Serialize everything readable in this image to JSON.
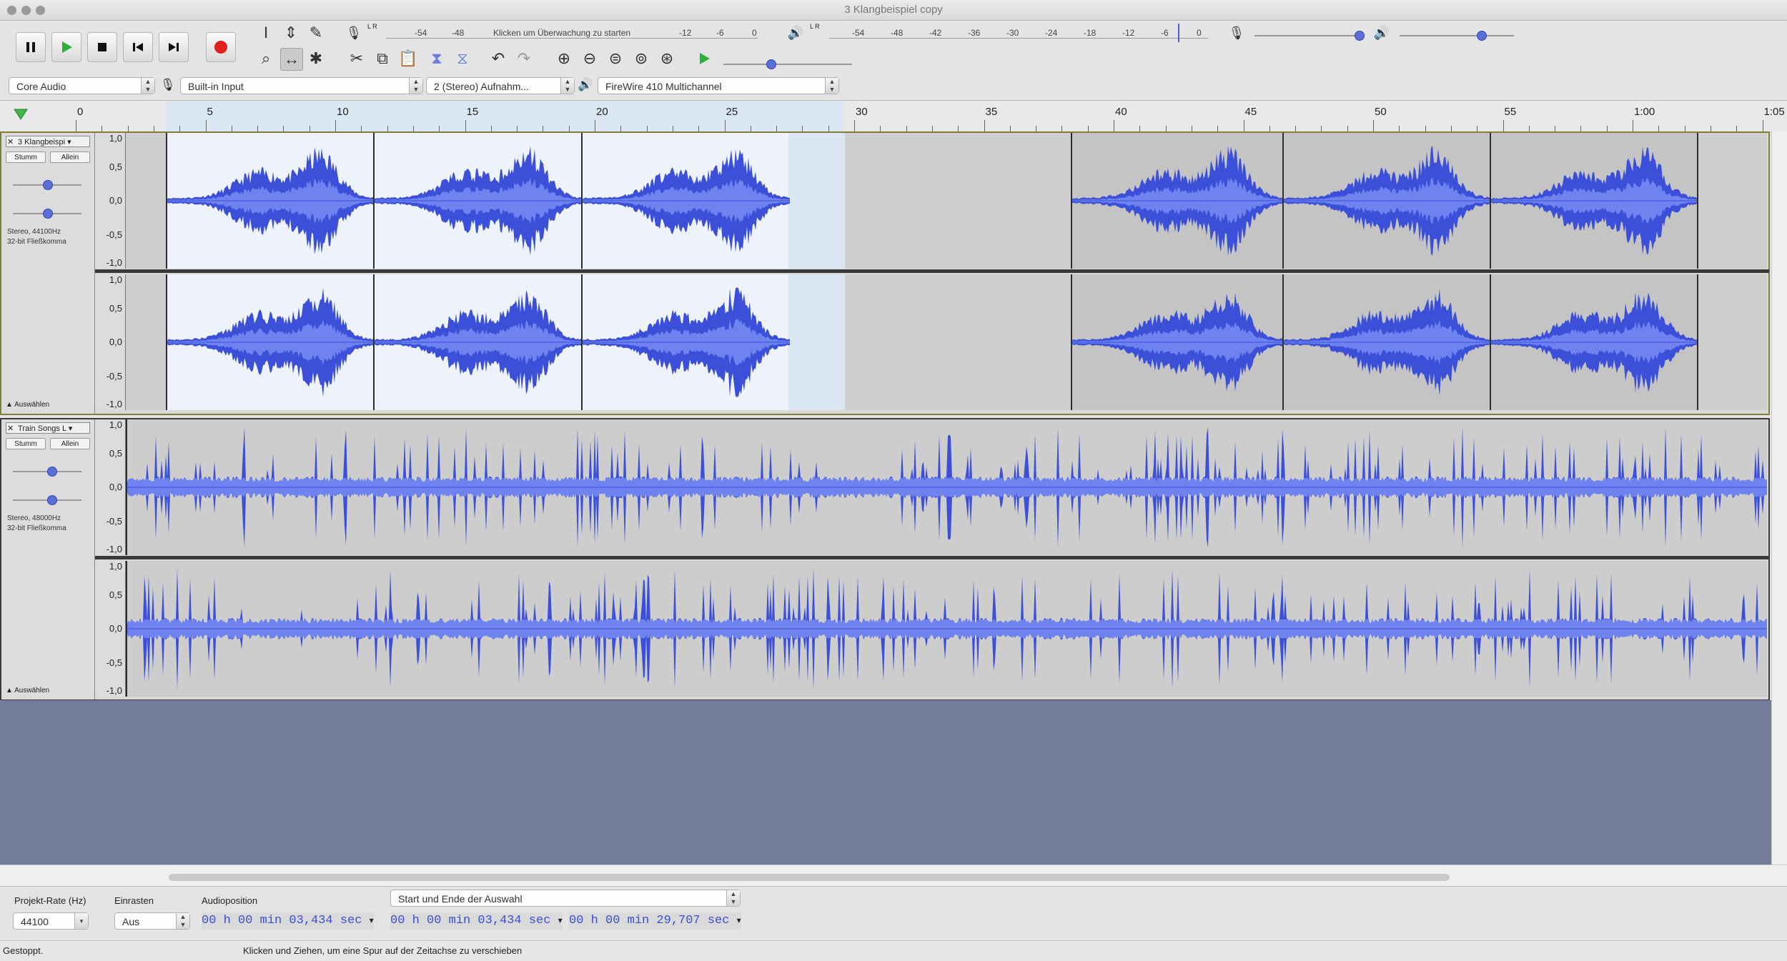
{
  "window": {
    "title": "3 Klangbeispiel copy"
  },
  "toolbar": {
    "transport": [
      "pause",
      "play",
      "stop",
      "skip-start",
      "skip-end",
      "record"
    ],
    "record_meter_label": "Klicken um Überwachung zu starten",
    "record_meter_ticks": [
      "-54",
      "-48",
      "-12",
      "-6",
      "0"
    ],
    "play_meter_ticks": [
      "-54",
      "-48",
      "-42",
      "-36",
      "-30",
      "-24",
      "-18",
      "-12",
      "-6",
      "0"
    ],
    "meter_lr": "L R",
    "host": "Core Audio",
    "input_device": "Built-in Input",
    "channels": "2 (Stereo) Aufnahm...",
    "output_device": "FireWire 410 Multichannel"
  },
  "ruler": {
    "labels": [
      "0",
      "5",
      "10",
      "15",
      "20",
      "25",
      "30",
      "35",
      "40",
      "45",
      "50",
      "55",
      "1:00",
      "1:05"
    ]
  },
  "tracks": [
    {
      "name": "3 Klangbeispi",
      "mute": "Stumm",
      "solo": "Allein",
      "info_rate": "Stereo, 44100Hz",
      "info_format": "32-bit Fließkomma",
      "select_label": "Auswählen",
      "scale": [
        "1,0",
        "0,5",
        "0,0",
        "-0,5",
        "-1,0"
      ]
    },
    {
      "name": "Train Songs L",
      "mute": "Stumm",
      "solo": "Allein",
      "info_rate": "Stereo, 48000Hz",
      "info_format": "32-bit Fließkomma",
      "select_label": "Auswählen",
      "scale": [
        "1,0",
        "0,5",
        "0,0",
        "-0,5",
        "-1,0"
      ]
    }
  ],
  "selection_bar": {
    "rate_label": "Projekt-Rate (Hz)",
    "rate_value": "44100",
    "snap_label": "Einrasten",
    "snap_value": "Aus",
    "audio_pos_label": "Audioposition",
    "audio_pos_value": "00 h 00 min 03,434 sec",
    "sel_mode": "Start und Ende der Auswahl",
    "sel_start": "00 h 00 min 03,434 sec",
    "sel_end": "00 h 00 min 29,707 sec"
  },
  "status": {
    "state": "Gestoppt.",
    "hint": "Klicken und Ziehen, um eine Spur auf der Zeitachse zu verschieben"
  },
  "colors": {
    "waveform": "#3b4fd8",
    "waveform_rms": "#6f83f0",
    "record": "#e0201c",
    "play": "#2fae3a"
  }
}
